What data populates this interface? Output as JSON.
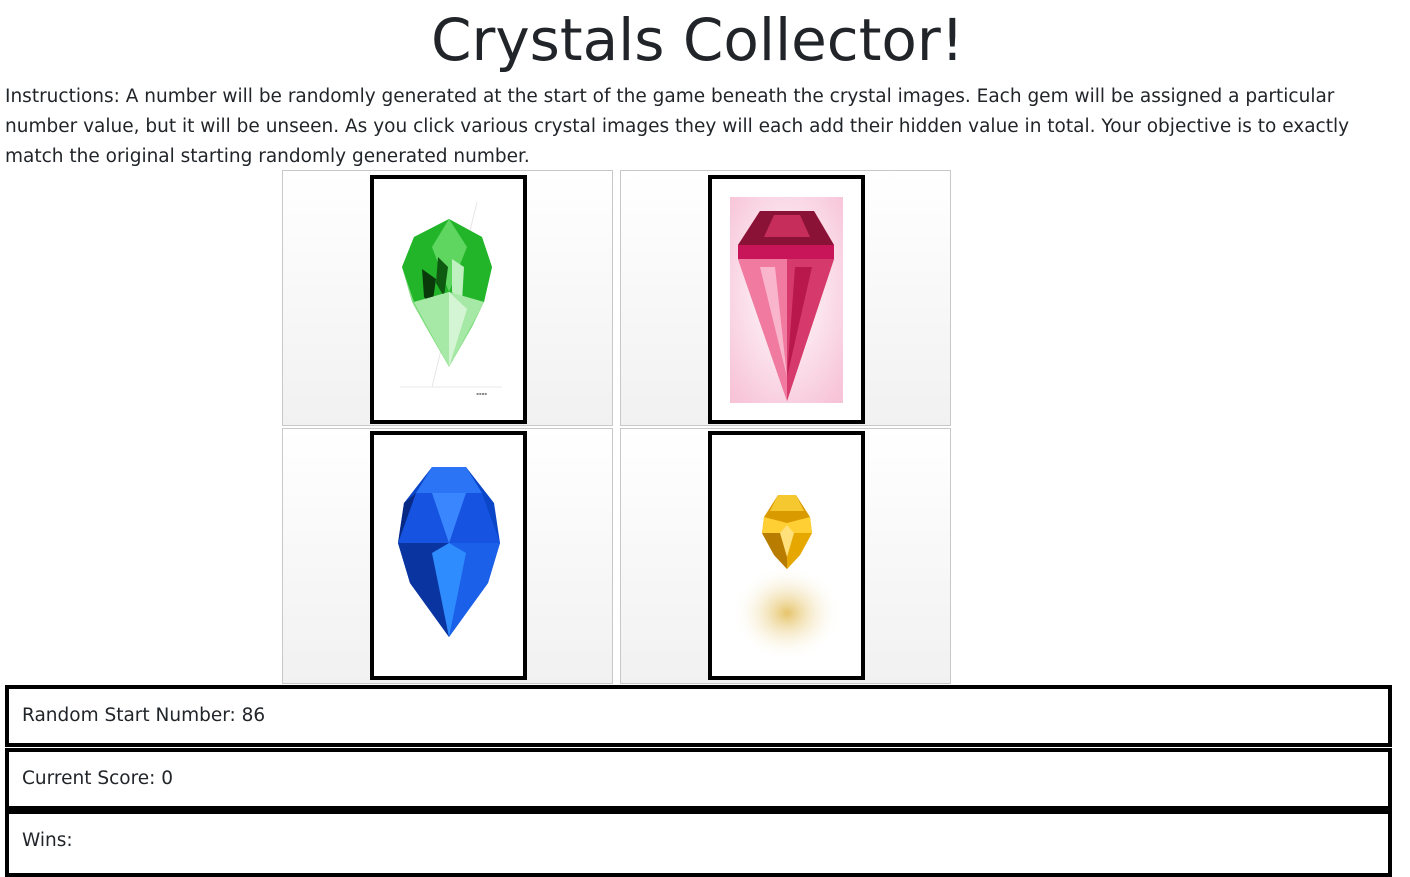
{
  "header": {
    "title": "Crystals Collector!"
  },
  "instructions": {
    "text": "Instructions: A number will be randomly generated at the start of the game beneath the crystal images. Each gem will be assigned a particular number value, but it will be unseen. As you click various crystal images they will each add their hidden value in total. Your objective is to exactly match the original starting randomly generated number."
  },
  "crystals": [
    {
      "name": "green-crystal",
      "icon": "green-crystal-icon",
      "color": "#2ecc40"
    },
    {
      "name": "pink-crystal",
      "icon": "pink-crystal-icon",
      "color": "#e84a7a"
    },
    {
      "name": "blue-crystal",
      "icon": "blue-crystal-icon",
      "color": "#1a5be0"
    },
    {
      "name": "yellow-crystal",
      "icon": "yellow-crystal-icon",
      "color": "#e0a800"
    }
  ],
  "stats": {
    "random_start_label": "Random Start Number: 86",
    "random_start_value": 86,
    "current_score_label": "Current Score: 0",
    "current_score_value": 0,
    "wins_label": "Wins:"
  }
}
